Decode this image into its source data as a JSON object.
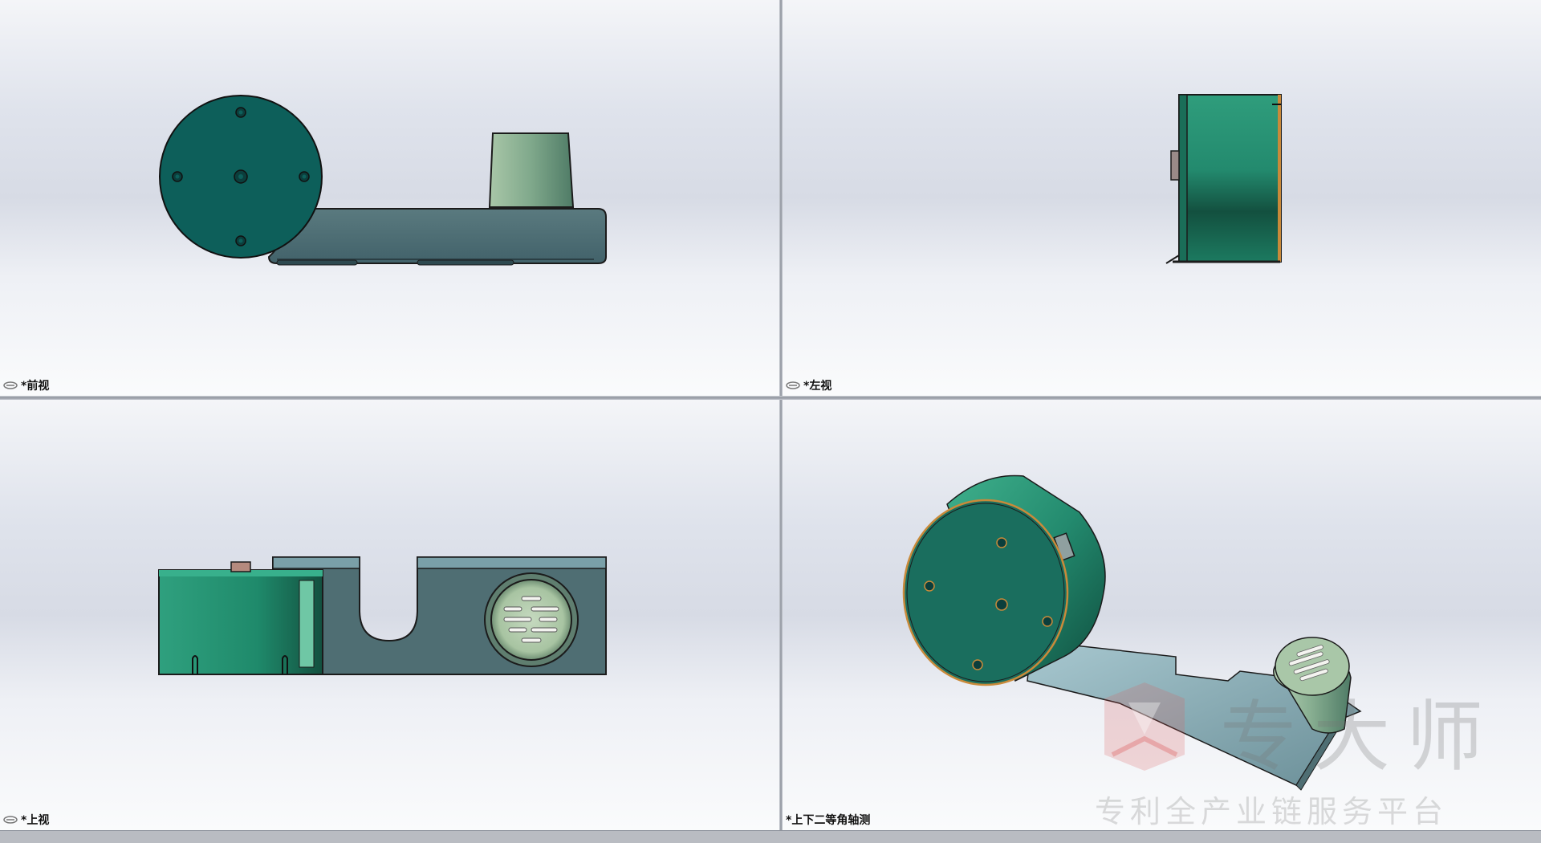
{
  "viewports": {
    "front": {
      "label": "*前视"
    },
    "left": {
      "label": "*左视"
    },
    "top": {
      "label": "*上视"
    },
    "iso": {
      "label": "*上下二等角轴测"
    }
  },
  "watermark": {
    "brand": "专大师",
    "tagline": "专利全产业链服务平台"
  },
  "icons": {
    "view_link": "link-icon"
  },
  "colors": {
    "drum_green": "#1f8a6e",
    "drum_dark": "#0d5f57",
    "base_steel": "#4f6e73",
    "cup_green": "#7aa58a",
    "edge": "#1b1b1b"
  }
}
